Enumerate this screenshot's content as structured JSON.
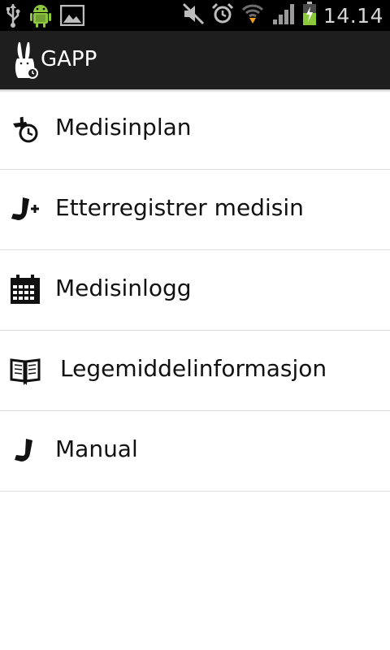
{
  "status_bar": {
    "time": "14.14",
    "icons": [
      "usb-icon",
      "android-debug-icon",
      "gallery-icon",
      "mute-icon",
      "alarm-icon",
      "wifi-icon",
      "signal-icon",
      "battery-charging-icon"
    ]
  },
  "action_bar": {
    "title": "GAPP",
    "icon": "gapp-rabbit-icon"
  },
  "menu": {
    "items": [
      {
        "label": "Medisinplan",
        "icon": "medication-plan-icon"
      },
      {
        "label": "Etterregistrer medisin",
        "icon": "add-medication-icon"
      },
      {
        "label": "Medisinlogg",
        "icon": "calendar-icon"
      },
      {
        "label": "Legemiddelinformasjon",
        "icon": "book-icon"
      },
      {
        "label": "Manual",
        "icon": "manual-icon"
      }
    ]
  },
  "colors": {
    "status_bar_bg": "#000000",
    "action_bar_bg": "#1e1e1e",
    "battery_green": "#8cc83c",
    "wifi_arrow_orange": "#f0a020",
    "divider": "#dcdcdc"
  }
}
